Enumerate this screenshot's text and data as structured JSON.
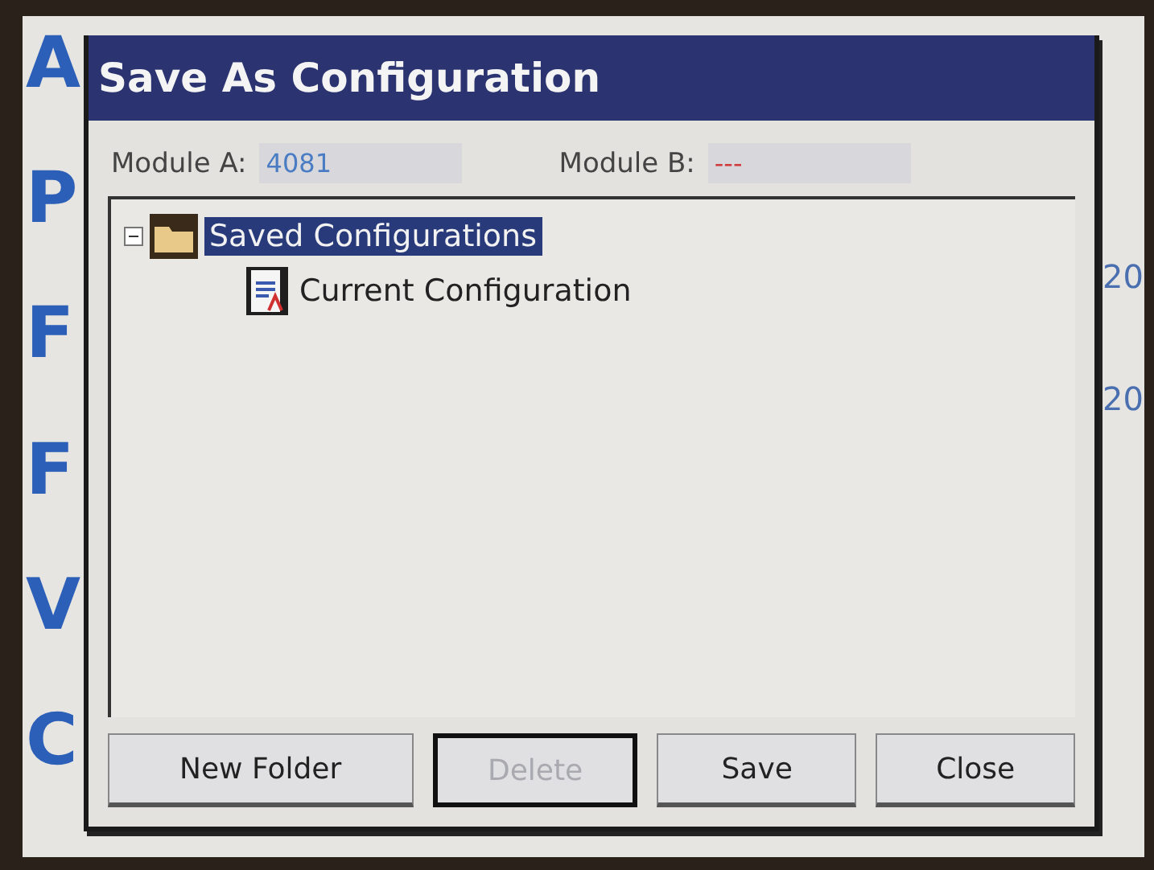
{
  "background": {
    "left_letters": [
      "A",
      "P",
      "F",
      "F",
      "V",
      "C"
    ],
    "right_values": [
      "20",
      "20"
    ]
  },
  "dialog": {
    "title": "Save As Configuration",
    "modules": [
      {
        "label": "Module A:",
        "value": "4081",
        "color": "#4a7cc4"
      },
      {
        "label": "Module B:",
        "value": "---",
        "color": "#d03a3a"
      }
    ],
    "tree": [
      {
        "label": "Saved Configurations",
        "kind": "folder",
        "selected": true,
        "expanded": true,
        "children": [
          {
            "label": "Current Configuration",
            "kind": "document",
            "selected": false
          }
        ]
      }
    ],
    "buttons": [
      {
        "label": "New Folder",
        "disabled": false,
        "focused": false
      },
      {
        "label": "Delete",
        "disabled": true,
        "focused": true
      },
      {
        "label": "Save",
        "disabled": false,
        "focused": false
      },
      {
        "label": "Close",
        "disabled": false,
        "focused": false
      }
    ]
  }
}
